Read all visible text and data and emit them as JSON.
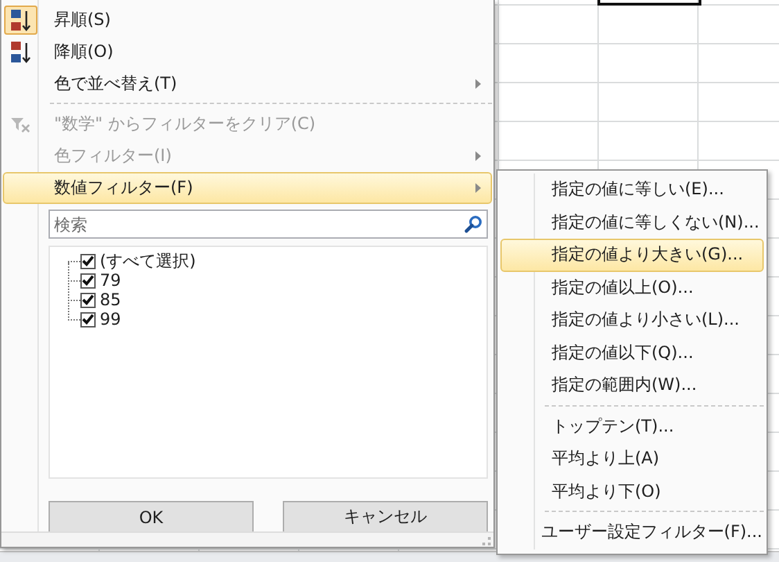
{
  "sort_menu": {
    "items": [
      {
        "kind": "sort_ascending",
        "label": "昇順(S)",
        "checked": true,
        "disabled": false,
        "selected": false,
        "has_submenu": false
      },
      {
        "kind": "sort_descending",
        "label": "降順(O)",
        "checked": false,
        "disabled": false,
        "selected": false,
        "has_submenu": false
      },
      {
        "kind": "command",
        "label": "色で並べ替え(T)",
        "checked": false,
        "disabled": false,
        "selected": false,
        "has_submenu": true
      },
      {
        "kind": "separator"
      },
      {
        "kind": "clear_filter",
        "label": "\"数学\" からフィルターをクリア(C)",
        "checked": false,
        "disabled": true,
        "selected": false,
        "has_submenu": false
      },
      {
        "kind": "command",
        "label": "色フィルター(I)",
        "checked": false,
        "disabled": true,
        "selected": false,
        "has_submenu": true
      },
      {
        "kind": "command",
        "label": "数値フィルター(F)",
        "checked": false,
        "disabled": false,
        "selected": true,
        "has_submenu": true
      }
    ]
  },
  "filter": {
    "search": {
      "placeholder": "検索"
    },
    "values": [
      {
        "label": "(すべて選択)",
        "checked": true
      },
      {
        "label": "79",
        "checked": true
      },
      {
        "label": "85",
        "checked": true
      },
      {
        "label": "99",
        "checked": true
      }
    ]
  },
  "buttons": [
    "OK",
    "キャンセル"
  ],
  "number_filter_menu": {
    "items": [
      {
        "kind": "command",
        "label": "指定の値に等しい(E)...",
        "selected": false
      },
      {
        "kind": "command",
        "label": "指定の値に等しくない(N)...",
        "selected": false
      },
      {
        "kind": "command",
        "label": "指定の値より大きい(G)...",
        "selected": true
      },
      {
        "kind": "command",
        "label": "指定の値以上(O)...",
        "selected": false
      },
      {
        "kind": "command",
        "label": "指定の値より小さい(L)...",
        "selected": false
      },
      {
        "kind": "command",
        "label": "指定の値以下(Q)...",
        "selected": false
      },
      {
        "kind": "command",
        "label": "指定の範囲内(W)...",
        "selected": false
      },
      {
        "kind": "separator"
      },
      {
        "kind": "command",
        "label": "トップテン(T)...",
        "selected": false
      },
      {
        "kind": "command",
        "label": "平均より上(A)",
        "selected": false
      },
      {
        "kind": "command",
        "label": "平均より下(O)",
        "selected": false
      },
      {
        "kind": "separator"
      },
      {
        "kind": "command",
        "label": "ユーザー設定フィルター(F)...",
        "selected": false
      }
    ]
  }
}
